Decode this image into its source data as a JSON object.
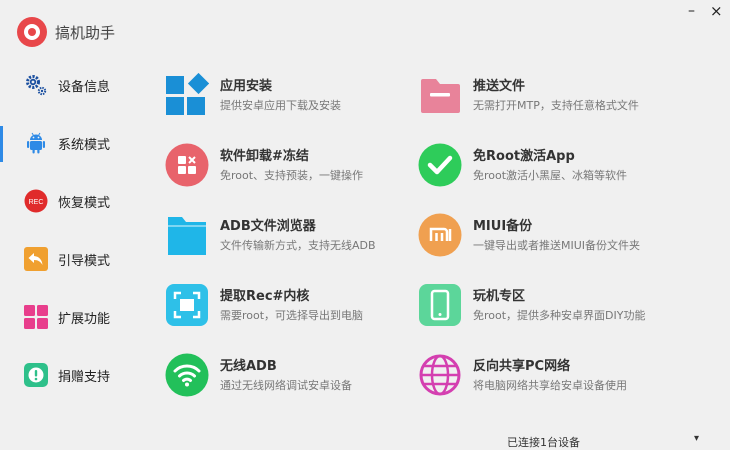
{
  "app": {
    "title": "搞机助手"
  },
  "window": {
    "minimize": "–",
    "close": "×"
  },
  "sidebar": {
    "items": [
      {
        "label": "设备信息",
        "icon": "gears-icon"
      },
      {
        "label": "系统模式",
        "icon": "android-icon",
        "active": true
      },
      {
        "label": "恢复模式",
        "icon": "rec-icon",
        "badge": "REC"
      },
      {
        "label": "引导模式",
        "icon": "back-arrow-icon"
      },
      {
        "label": "扩展功能",
        "icon": "grid-icon"
      },
      {
        "label": "捐赠支持",
        "icon": "alert-icon"
      }
    ]
  },
  "features": [
    {
      "title": "应用安装",
      "desc": "提供安卓应用下载及安装",
      "icon": "app-install-icon",
      "color": "#1a8fd6"
    },
    {
      "title": "推送文件",
      "desc": "无需打开MTP，支持任意格式文件",
      "icon": "folder-push-icon",
      "color": "#e8839a"
    },
    {
      "title": "软件卸载#冻结",
      "desc": "免root、支持预装，一键操作",
      "icon": "uninstall-icon",
      "color": "#e8636b"
    },
    {
      "title": "免Root激活App",
      "desc": "免root激活小黑屋、冰箱等软件",
      "icon": "check-icon",
      "color": "#2ecc5a"
    },
    {
      "title": "ADB文件浏览器",
      "desc": "文件传输新方式，支持无线ADB",
      "icon": "folder-icon",
      "color": "#1fb6e8"
    },
    {
      "title": "MIUI备份",
      "desc": "一键导出或者推送MIUI备份文件夹",
      "icon": "mi-icon",
      "color": "#f0a050"
    },
    {
      "title": "提取Rec#内核",
      "desc": "需要root，可选择导出到电脑",
      "icon": "extract-icon",
      "color": "#2ec0e8"
    },
    {
      "title": "玩机专区",
      "desc": "免root，提供多种安卓界面DIY功能",
      "icon": "phone-icon",
      "color": "#5cd69a"
    },
    {
      "title": "无线ADB",
      "desc": "通过无线网络调试安卓设备",
      "icon": "wifi-icon",
      "color": "#22c05a"
    },
    {
      "title": "反向共享PC网络",
      "desc": "将电脑网络共享给安卓设备使用",
      "icon": "globe-icon",
      "color": "#d43fb0"
    }
  ],
  "status": {
    "text": "已连接1台设备",
    "caret": "▾"
  }
}
